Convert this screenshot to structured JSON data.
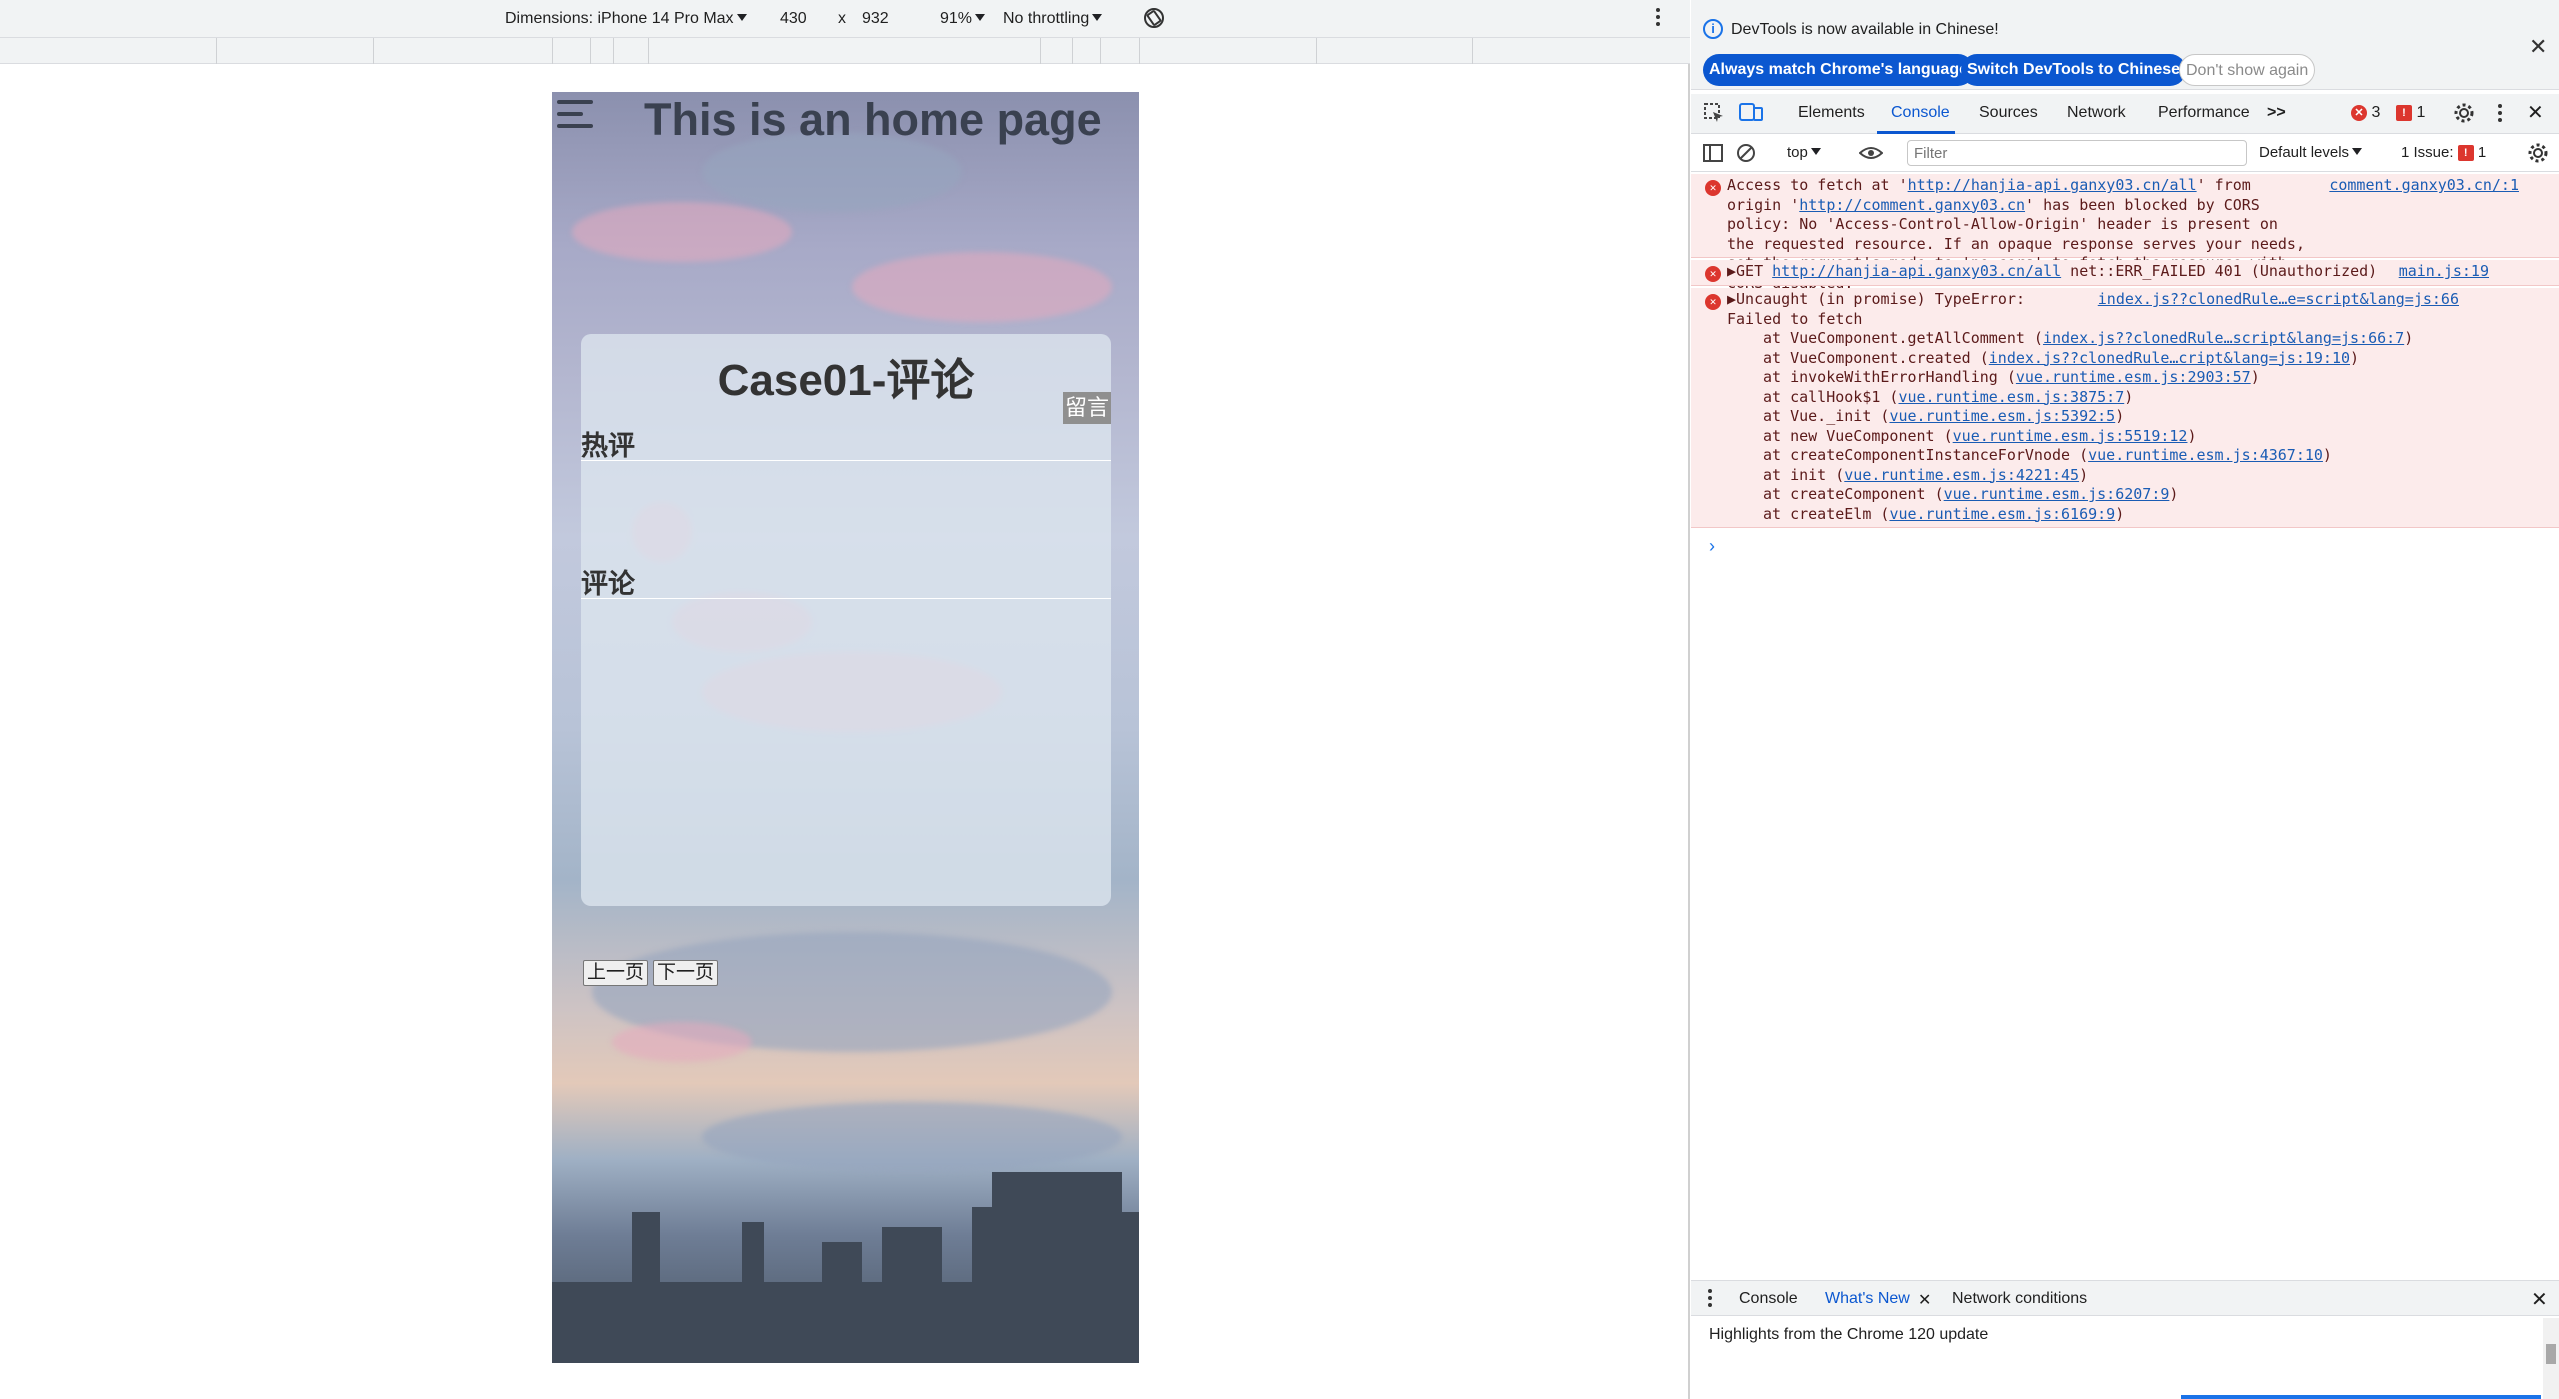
{
  "device_toolbar": {
    "dimensions_label": "Dimensions: iPhone 14 Pro Max",
    "width": "430",
    "times": "x",
    "height": "932",
    "zoom": "91%",
    "throttling": "No throttling"
  },
  "page": {
    "title": "This is an home page",
    "card_title": "Case01-评论",
    "message_button": "留言",
    "hot_section": "热评",
    "comment_section": "评论",
    "prev_button": "上一页",
    "next_button": "下一页"
  },
  "devtools": {
    "info_text": "DevTools is now available in Chinese!",
    "btn_match": "Always match Chrome's language",
    "btn_switch": "Switch DevTools to Chinese",
    "btn_dont_show": "Don't show again",
    "tabs": [
      "Elements",
      "Console",
      "Sources",
      "Network",
      "Performance"
    ],
    "more_tabs": ">>",
    "error_count": "3",
    "issue_count": "1",
    "context": "top",
    "filter_placeholder": "Filter",
    "levels": "Default levels",
    "issues_label": "1 Issue:",
    "issues_num": "1",
    "messages": [
      {
        "text_a": "Access to fetch at '",
        "url1": "http://hanjia-api.ganxy03.cn/all",
        "text_b": "' from origin",
        "text_c": "'",
        "url2": "http://comment.ganxy03.cn",
        "text_d": "' has been blocked by CORS policy: No 'Access-Control-Allow-Origin' header is present on the requested resource. If an opaque response serves your needs, set the request's mode to 'no-cors' to fetch the resource with CORS disabled.",
        "source": "comment.ganxy03.cn/:1"
      },
      {
        "prefix": "▶GET ",
        "url": "http://hanjia-api.ganxy03.cn/all",
        "text": " net::ERR_FAILED 401 (Unauthorized)",
        "source": "main.js:19"
      },
      {
        "line1": "▶Uncaught (in promise) TypeError:",
        "line2": "Failed to fetch",
        "source": "index.js??clonedRule…e=script&lang=js:66",
        "stack": [
          {
            "at": "at VueComponent.getAllComment (",
            "link": "index.js??clonedRule…script&lang=js:66:7",
            "end": ")"
          },
          {
            "at": "at VueComponent.created (",
            "link": "index.js??clonedRule…cript&lang=js:19:10",
            "end": ")"
          },
          {
            "at": "at invokeWithErrorHandling (",
            "link": "vue.runtime.esm.js:2903:57",
            "end": ")"
          },
          {
            "at": "at callHook$1 (",
            "link": "vue.runtime.esm.js:3875:7",
            "end": ")"
          },
          {
            "at": "at Vue._init (",
            "link": "vue.runtime.esm.js:5392:5",
            "end": ")"
          },
          {
            "at": "at new VueComponent (",
            "link": "vue.runtime.esm.js:5519:12",
            "end": ")"
          },
          {
            "at": "at createComponentInstanceForVnode (",
            "link": "vue.runtime.esm.js:4367:10",
            "end": ")"
          },
          {
            "at": "at init (",
            "link": "vue.runtime.esm.js:4221:45",
            "end": ")"
          },
          {
            "at": "at createComponent (",
            "link": "vue.runtime.esm.js:6207:9",
            "end": ")"
          },
          {
            "at": "at createElm (",
            "link": "vue.runtime.esm.js:6169:9",
            "end": ")"
          }
        ]
      }
    ],
    "prompt": "›",
    "drawer_tabs": [
      "Console",
      "What's New",
      "Network conditions"
    ],
    "drawer_body": "Highlights from the Chrome 120 update"
  }
}
